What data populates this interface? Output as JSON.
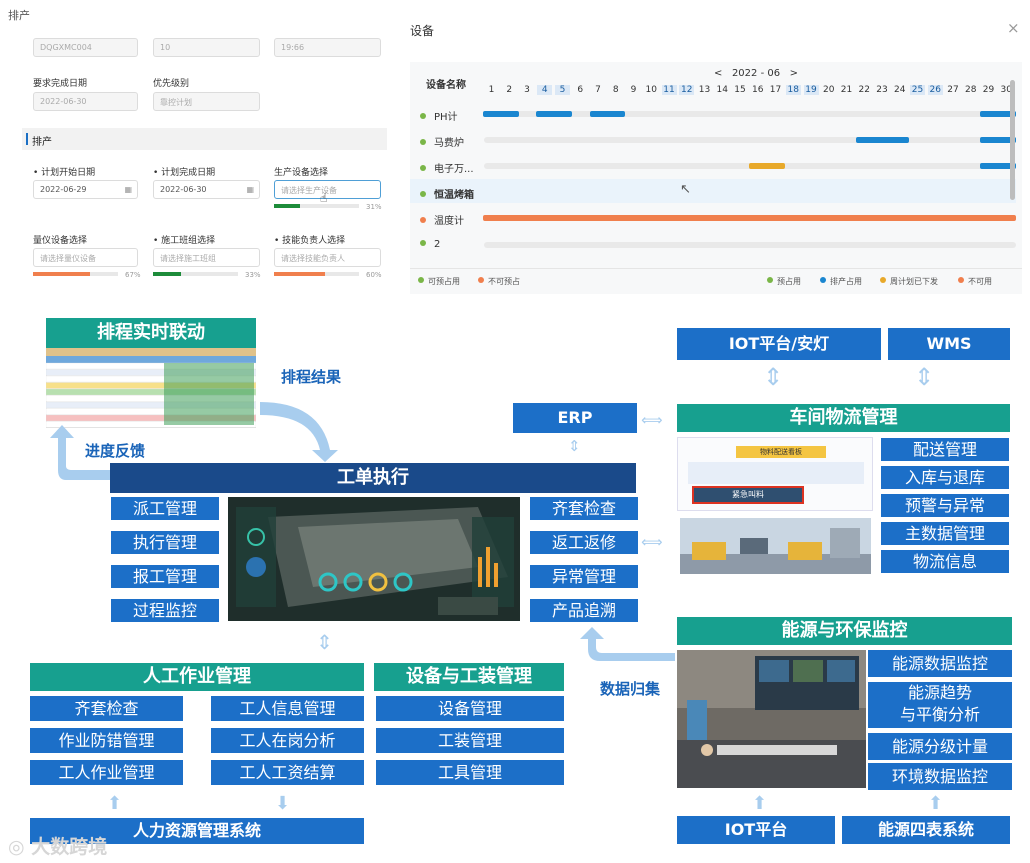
{
  "scheduling_form": {
    "title": "排产",
    "top_values": [
      "DQGXMC004",
      "10",
      "19:66"
    ],
    "required_date_label": "要求完成日期",
    "required_date_value": "2022-06-30",
    "priority_label": "优先级别",
    "priority_value": "靠控计划",
    "section_title": "排产",
    "plan_start_label": "计划开始日期",
    "plan_start_value": "2022-06-29",
    "plan_end_label": "计划完成日期",
    "plan_end_value": "2022-06-30",
    "device_select_label": "生产设备选择",
    "device_select_placeholder": "请选择生产设备",
    "device_select_pct": "31%",
    "device_select_progress": 0.31,
    "measure_label": "量仪设备选择",
    "measure_placeholder": "请选择量仪设备",
    "measure_pct": "67%",
    "measure_progress": 0.67,
    "team_label": "施工班组选择",
    "team_placeholder": "请选择施工班组",
    "team_pct": "33%",
    "team_progress": 0.33,
    "tech_label": "技能负责人选择",
    "tech_placeholder": "请选择技能负责人",
    "tech_pct": "60%",
    "tech_progress": 0.6
  },
  "device_modal": {
    "title": "设备",
    "close": "×",
    "column_header": "设备名称",
    "month_prev": "<",
    "month": "2022 - 06",
    "month_next": ">",
    "days": [
      "1",
      "2",
      "3",
      "4",
      "5",
      "6",
      "7",
      "8",
      "9",
      "10",
      "11",
      "12",
      "13",
      "14",
      "15",
      "16",
      "17",
      "18",
      "19",
      "20",
      "21",
      "22",
      "23",
      "24",
      "25",
      "26",
      "27",
      "28",
      "29",
      "30"
    ],
    "highlight_days": [
      "4",
      "5",
      "11",
      "12",
      "18",
      "19",
      "25",
      "26"
    ],
    "rows": [
      {
        "name": "PH计",
        "status": "green"
      },
      {
        "name": "马费炉",
        "status": "green"
      },
      {
        "name": "电子万...",
        "status": "green"
      },
      {
        "name": "恒温烤箱",
        "status": "green"
      },
      {
        "name": "温度计",
        "status": "orange"
      },
      {
        "name": "2",
        "status": "green"
      }
    ],
    "legend_left": [
      "可预占用",
      "不可预占"
    ],
    "legend_right": [
      "预占用",
      "排产占用",
      "周计划已下发",
      "不可用"
    ]
  },
  "diagram": {
    "schedule_realtime": "排程实时联动",
    "schedule_result": "排程结果",
    "progress_feedback": "进度反馈",
    "work_order_exec": "工单执行",
    "left_boxes": [
      "派工管理",
      "执行管理",
      "报工管理",
      "过程监控"
    ],
    "right_boxes": [
      "齐套检查",
      "返工返修",
      "异常管理",
      "产品追溯"
    ],
    "erp": "ERP",
    "iot_andon": "IOT平台/安灯",
    "wms": "WMS",
    "logistics": "车间物流管理",
    "logistics_items": [
      "配送管理",
      "入库与退库",
      "预警与异常",
      "主数据管理",
      "物流信息"
    ],
    "board_title": "物料配送看板",
    "urgent_btn": "紧急叫料",
    "manual_ops": "人工作业管理",
    "manual_left": [
      "齐套检查",
      "作业防错管理",
      "工人作业管理"
    ],
    "manual_right": [
      "工人信息管理",
      "工人在岗分析",
      "工人工资结算"
    ],
    "equip_tooling": "设备与工装管理",
    "equip_items": [
      "设备管理",
      "工装管理",
      "工具管理"
    ],
    "hr_system": "人力资源管理系统",
    "data_collect": "数据归集",
    "energy": "能源与环保监控",
    "energy_items": [
      "能源数据监控",
      "能源趋势\n与平衡分析",
      "能源分级计量",
      "环境数据监控"
    ],
    "iot_platform": "IOT平台",
    "energy_meters": "能源四表系统",
    "watermark": "大数跨境"
  },
  "colors": {
    "teal": "#17a08f",
    "blue": "#1c6fc8",
    "navy": "#1a4a8a",
    "green": "#7ab648",
    "orange": "#f07f4d",
    "gantt_blue": "#1a86d0",
    "gantt_yellow": "#e8a92a"
  }
}
